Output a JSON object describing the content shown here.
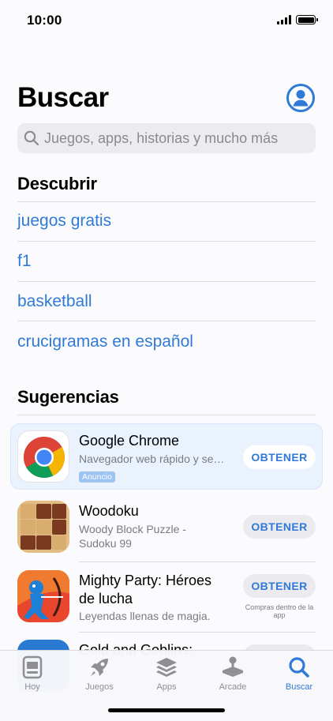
{
  "status_bar": {
    "time": "10:00"
  },
  "header": {
    "title": "Buscar"
  },
  "search": {
    "placeholder": "Juegos, apps, historias y mucho más"
  },
  "discover": {
    "title": "Descubrir",
    "items": [
      "juegos gratis",
      "f1",
      "basketball",
      "crucigramas en español"
    ]
  },
  "suggestions": {
    "title": "Sugerencias",
    "apps": [
      {
        "name": "Google Chrome",
        "subtitle": "Navegador web rápido y se…",
        "badge": "Anuncio",
        "button": "OBTENER",
        "icon": "chrome-icon"
      },
      {
        "name": "Woodoku",
        "subtitle": "Woody Block Puzzle - Sudoku 99",
        "button": "OBTENER",
        "icon": "woodoku-icon"
      },
      {
        "name": "Mighty Party: Héroes de lucha",
        "subtitle": "Leyendas llenas de magia.",
        "button": "OBTENER",
        "note": "Compras dentro de la app",
        "icon": "mighty-party-icon"
      },
      {
        "name": "Gold and Goblins:",
        "icon": "gold-goblins-icon"
      }
    ]
  },
  "tabs": [
    {
      "label": "Hoy",
      "icon": "today-icon"
    },
    {
      "label": "Juegos",
      "icon": "rocket-icon"
    },
    {
      "label": "Apps",
      "icon": "layers-icon"
    },
    {
      "label": "Arcade",
      "icon": "joystick-icon"
    },
    {
      "label": "Buscar",
      "icon": "search-icon",
      "active": true
    }
  ],
  "colors": {
    "accent": "#2f7ad7",
    "ad_background": "#e9f2fd",
    "background": "#fbfbfd"
  }
}
